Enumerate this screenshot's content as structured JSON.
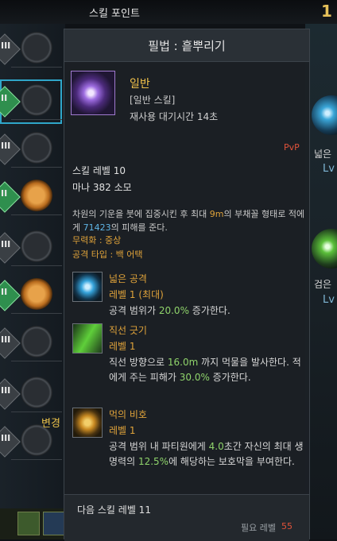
{
  "top": {
    "title": "스킬 포인트",
    "points_partial": "1"
  },
  "left_rows": [
    {
      "tri": "III",
      "tri_color": "grey",
      "circle": "empty",
      "selected": false
    },
    {
      "tri": "II",
      "tri_color": "green",
      "circle": "empty",
      "selected": true
    },
    {
      "tri": "III",
      "tri_color": "grey",
      "circle": "empty",
      "selected": false
    },
    {
      "tri": "II",
      "tri_color": "green",
      "circle": "orange",
      "selected": false
    },
    {
      "tri": "III",
      "tri_color": "grey",
      "circle": "empty",
      "selected": false
    },
    {
      "tri": "II",
      "tri_color": "green",
      "circle": "orange",
      "selected": false
    },
    {
      "tri": "III",
      "tri_color": "grey",
      "circle": "empty",
      "selected": false
    },
    {
      "tri": "III",
      "tri_color": "grey",
      "circle": "empty",
      "selected": false
    },
    {
      "tri": "III",
      "tri_color": "grey",
      "circle": "empty",
      "selected": false
    }
  ],
  "change_label": "변경",
  "right": {
    "skill1_label": "넓은",
    "skill1_lv": "Lv",
    "skill2_label": "검은",
    "skill2_lv": "Lv"
  },
  "panel": {
    "title": "필법 : 흩뿌리기",
    "skill_type": "일반",
    "skill_category": "[일반 스킬]",
    "cooldown": "재사용 대기시간 14초",
    "pvp": "PvP",
    "skill_level": "스킬 레벨 10",
    "mana": "마나 382 소모",
    "desc_pre": "차원의 기운을 붓에 집중시킨 후 최대 ",
    "desc_range": "9m",
    "desc_mid": "의 부채꼴 형태로 적에게 ",
    "desc_damage": "71423",
    "desc_post": "의 피해를 준다.",
    "neutralize": "무력화 : 중상",
    "attack_type": "공격 타입 : 백 어택",
    "tripods": [
      {
        "name": "넓은 공격",
        "level": "레벨 1 (최대)",
        "desc": [
          {
            "t": "공격 범위가 ",
            "g": false
          },
          {
            "t": "20.0%",
            "g": true
          },
          {
            "t": " 증가한다.",
            "g": false
          }
        ],
        "icon": "wide-attack-icon"
      },
      {
        "name": "직선 긋기",
        "level": "레벨 1",
        "desc": [
          {
            "t": "직선 방향으로 ",
            "g": false
          },
          {
            "t": "16.0m",
            "g": true
          },
          {
            "t": " 까지 먹물을 발사한다. 적에게 주는 피해가 ",
            "g": false
          },
          {
            "t": "30.0%",
            "g": true
          },
          {
            "t": " 증가한다.",
            "g": false
          }
        ],
        "icon": "straight-line-icon"
      },
      {
        "name": "먹의 비호",
        "level": "레벨 1",
        "desc": [
          {
            "t": "공격 범위 내 파티원에게 ",
            "g": false
          },
          {
            "t": "4.0",
            "g": true
          },
          {
            "t": "초간 자신의 최대 생명력의 ",
            "g": false
          },
          {
            "t": "12.5%",
            "g": true
          },
          {
            "t": "에 해당하는 보호막을 부여한다.",
            "g": false
          }
        ],
        "icon": "ink-protection-icon"
      }
    ],
    "next_level": "다음 스킬 레벨 11",
    "required_label": "필요 레벨",
    "required_value": "55"
  }
}
